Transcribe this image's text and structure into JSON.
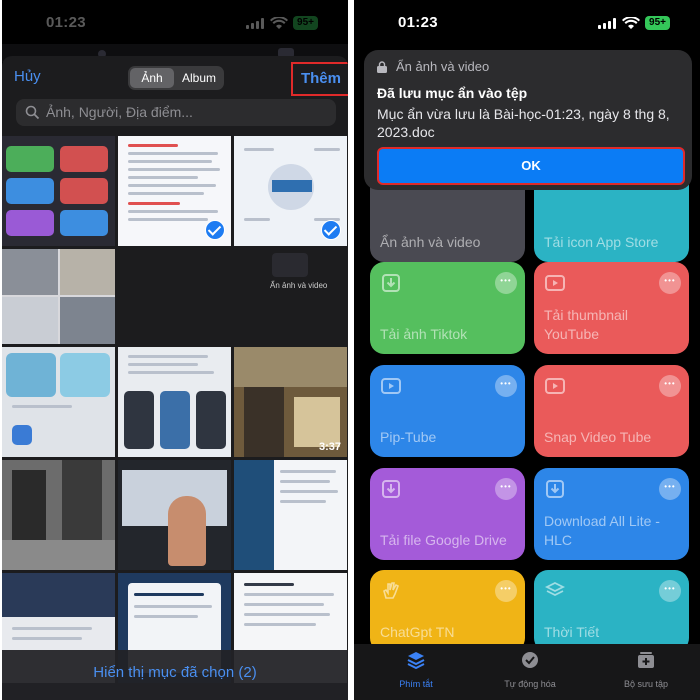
{
  "status": {
    "time": "01:23",
    "battery": "95+"
  },
  "picker": {
    "cancel": "Hủy",
    "segments": [
      "Ảnh",
      "Album"
    ],
    "add": "Thêm",
    "search_placeholder": "Ảnh, Người, Địa điểm...",
    "video_duration": "3:37",
    "grid_caption": "Ẩn ảnh và video",
    "show_selected": "Hiển thị mục đã chọn (2)"
  },
  "alert": {
    "app_name": "Ẩn ảnh và video",
    "title": "Đã lưu mục ẩn vào tệp",
    "body": "Mục ẩn vừa lưu là Bài-học-01:23, ngày 8 thg 8, 2023.doc",
    "ok": "OK"
  },
  "shortcuts": [
    {
      "title": "Ẩn ảnh và video",
      "color": "#4a4a52",
      "icon": "none"
    },
    {
      "title": "Tải icon App Store",
      "color": "#2bb3c4",
      "icon": "none"
    },
    {
      "title": "Tải ảnh Tiktok",
      "color": "#55bf5e",
      "icon": "download-icon"
    },
    {
      "title": "Tải thumbnail YouTube",
      "color": "#ea5a5a",
      "icon": "play-icon"
    },
    {
      "title": "Pip-Tube",
      "color": "#2d86e8",
      "icon": "play-icon"
    },
    {
      "title": "Snap Video Tube",
      "color": "#ea5a5a",
      "icon": "play-icon"
    },
    {
      "title": "Tải file Google Drive",
      "color": "#a45bd9",
      "icon": "download-icon"
    },
    {
      "title": "Download All Lite - HLC",
      "color": "#2d86e8",
      "icon": "download-icon"
    },
    {
      "title": "ChatGpt TN",
      "color": "#f0b416",
      "icon": "hand-icon"
    },
    {
      "title": "Thời Tiết",
      "color": "#2bb3c4",
      "icon": "layers-icon"
    }
  ],
  "tabs": [
    {
      "label": "Phím tắt",
      "active": true
    },
    {
      "label": "Tự động hóa",
      "active": false
    },
    {
      "label": "Bộ sưu tập",
      "active": false
    }
  ],
  "colors": {
    "accent": "#4a8ff0",
    "highlight_border": "#e02a2a",
    "ok_blue": "#0b7cf5"
  }
}
